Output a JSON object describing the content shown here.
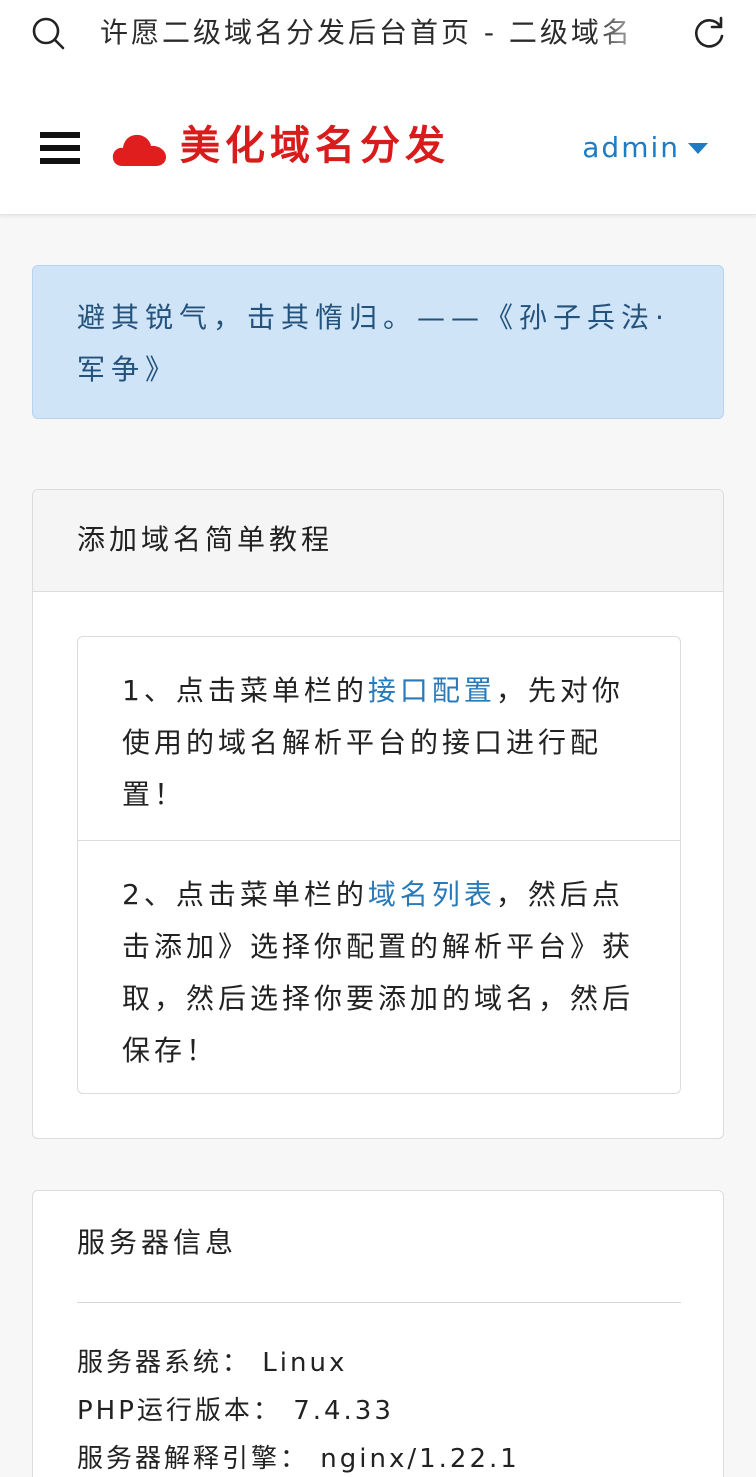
{
  "browser": {
    "page_title": "许愿二级域名分发后台首页 - 二级域名"
  },
  "header": {
    "brand_name": "美化域名分发",
    "username": "admin"
  },
  "quote": {
    "text": "避其锐气，击其惰归。——《孙子兵法·军争》"
  },
  "tutorial": {
    "title": "添加域名简单教程",
    "steps": [
      {
        "prefix": "1、点击菜单栏的",
        "link": "接口配置",
        "suffix": "，先对你使用的域名解析平台的接口进行配置！"
      },
      {
        "prefix": "2、点击菜单栏的",
        "link": "域名列表",
        "suffix": "，然后点击添加》选择你配置的解析平台》获取，然后选择你要添加的域名，然后保存！"
      }
    ]
  },
  "server": {
    "title": "服务器信息",
    "rows": [
      {
        "label": "服务器系统：",
        "value": "Linux"
      },
      {
        "label": "PHP运行版本：",
        "value": "7.4.33"
      },
      {
        "label": "服务器解释引擎：",
        "value": "nginx/1.22.1"
      }
    ]
  },
  "colors": {
    "brand": "#d81b1b",
    "link": "#2a7ab8",
    "alert_bg": "#d0e4f8",
    "alert_text": "#23527c"
  }
}
